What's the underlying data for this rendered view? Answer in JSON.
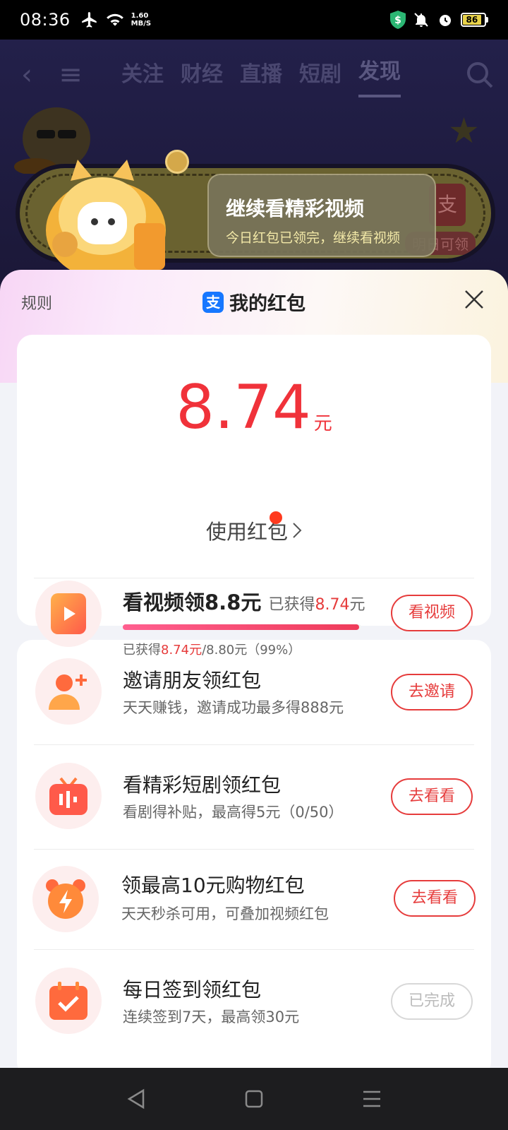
{
  "status_bar": {
    "time": "08:36",
    "net_speed_value": "1.60",
    "net_speed_unit": "MB/S",
    "battery": "86"
  },
  "background_app": {
    "tabs": [
      "关注",
      "财经",
      "直播",
      "短剧",
      "发现"
    ],
    "active_tab": "发现",
    "banner_tag": "明日可领",
    "toast": {
      "title": "继续看精彩视频",
      "subtitle": "今日红包已领完，继续看视频"
    }
  },
  "sheet": {
    "rules_label": "规则",
    "title": "我的红包",
    "title_icon_glyph": "支",
    "amount": "8.74",
    "amount_unit": "元",
    "use_label": "使用红包",
    "video_task": {
      "title": "看视频领8.8元",
      "earned_prefix": "已获得",
      "earned_value": "8.74",
      "earned_unit": "元",
      "progress_fraction": 0.99,
      "progress_prefix": "已获得",
      "progress_value": "8.74元",
      "progress_suffix": "/8.80元（99%）",
      "button": "看视频"
    },
    "tasks": [
      {
        "title": "邀请朋友领红包",
        "subtitle": "天天赚钱，邀请成功最多得888元",
        "button": "去邀请",
        "icon": "invite-friend-icon",
        "done": false
      },
      {
        "title": "看精彩短剧领红包",
        "subtitle": "看剧得补贴，最高得5元（0/50）",
        "button": "去看看",
        "icon": "tv-icon",
        "done": false
      },
      {
        "title": "领最高10元购物红包",
        "subtitle": "天天秒杀可用，可叠加视频红包",
        "button": "去看看",
        "icon": "alarm-clock-icon",
        "done": false
      },
      {
        "title": "每日签到领红包",
        "subtitle": "连续签到7天，最高领30元",
        "button": "已完成",
        "icon": "calendar-check-icon",
        "done": true
      }
    ]
  },
  "colors": {
    "accent_red": "#e63c3c",
    "amount_red": "#f0323a",
    "alipay_blue": "#1677ff"
  }
}
